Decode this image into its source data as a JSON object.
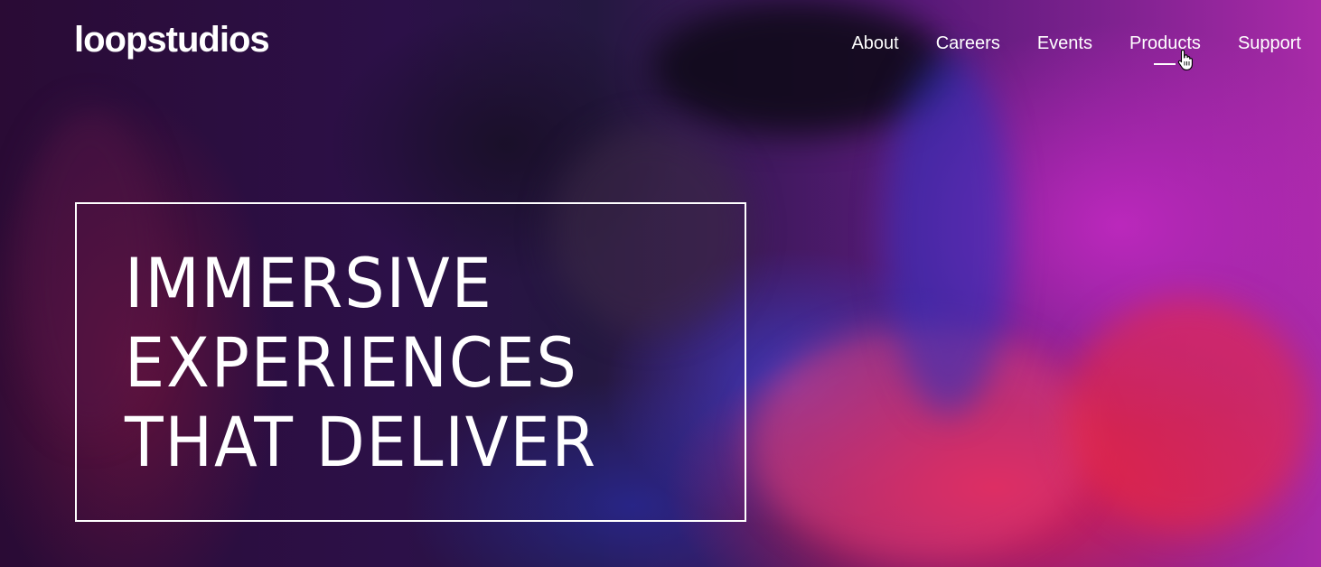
{
  "header": {
    "logo": "loopstudios",
    "nav": [
      {
        "label": "About"
      },
      {
        "label": "Careers"
      },
      {
        "label": "Events"
      },
      {
        "label": "Products",
        "active": true
      },
      {
        "label": "Support"
      }
    ]
  },
  "hero": {
    "headline_lines": [
      "IMMERSIVE",
      "EXPERIENCES",
      "THAT DELIVER"
    ]
  },
  "colors": {
    "text": "#ffffff",
    "accent_magenta": "#a82aa8",
    "accent_red": "#eb1e46",
    "accent_blue": "#3c3cc8"
  },
  "icons": {
    "cursor": "hand-pointer-icon"
  }
}
